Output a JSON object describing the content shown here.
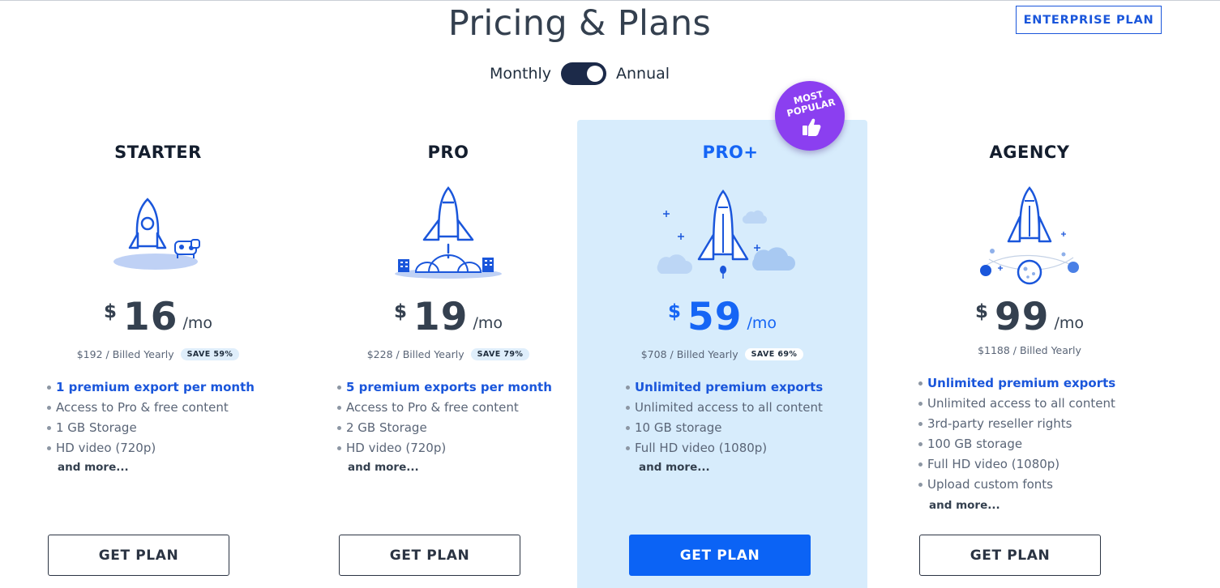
{
  "header": {
    "title": "Pricing & Plans",
    "enterprise_label": "ENTERPRISE PLAN"
  },
  "billing_toggle": {
    "monthly_label": "Monthly",
    "annual_label": "Annual",
    "selected": "Annual"
  },
  "badge": {
    "line1": "MOST",
    "line2": "POPULAR"
  },
  "colors": {
    "accent": "#1565f5",
    "button_primary": "#0b63f5",
    "featured_bg": "#d7ecfc",
    "badge_purple": "#8b3ff0",
    "toggle": "#1c2a49"
  },
  "plans": [
    {
      "name": "STARTER",
      "currency": "$",
      "amount": "16",
      "period": "/mo",
      "billed": "$192 / Billed Yearly",
      "save": "SAVE 59%",
      "features": [
        "1 premium export per month",
        "Access to Pro & free content",
        "1 GB Storage",
        "HD video (720p)"
      ],
      "more": "and more...",
      "button": "GET PLAN",
      "illustration": "rocket-with-cow-icon"
    },
    {
      "name": "PRO",
      "currency": "$",
      "amount": "19",
      "period": "/mo",
      "billed": "$228 / Billed Yearly",
      "save": "SAVE 79%",
      "features": [
        "5 premium exports per month",
        "Access to Pro & free content",
        "2 GB Storage",
        "HD video (720p)"
      ],
      "more": "and more...",
      "button": "GET PLAN",
      "illustration": "shuttle-launch-icon"
    },
    {
      "name": "PRO+",
      "currency": "$",
      "amount": "59",
      "period": "/mo",
      "billed": "$708 / Billed Yearly",
      "save": "SAVE 69%",
      "features": [
        "Unlimited premium exports",
        "Unlimited access to all content",
        "10 GB storage",
        "Full HD video (1080p)"
      ],
      "more": "and more...",
      "button": "GET PLAN",
      "illustration": "shuttle-in-clouds-icon"
    },
    {
      "name": "AGENCY",
      "currency": "$",
      "amount": "99",
      "period": "/mo",
      "billed": "$1188 / Billed Yearly",
      "features": [
        "Unlimited premium exports",
        "Unlimited access to all content",
        "3rd-party reseller rights",
        "100 GB storage",
        "Full HD video (1080p)",
        "Upload custom fonts"
      ],
      "more": "and more...",
      "button": "GET PLAN",
      "illustration": "shuttle-in-space-icon"
    }
  ]
}
